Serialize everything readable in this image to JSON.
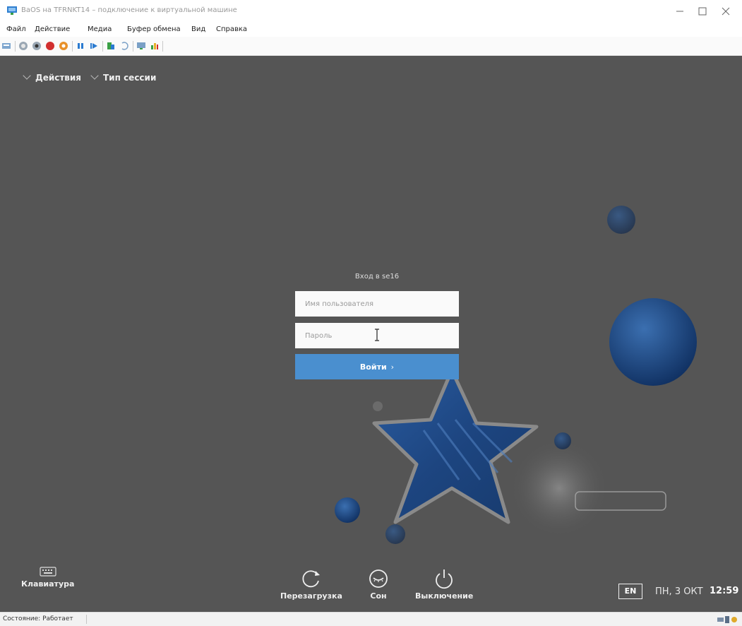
{
  "window": {
    "title": "BaOS на TFRNKT14 – подключение к виртуальной машине"
  },
  "menu": [
    "Файл",
    "Действие",
    "Медиа",
    "Буфер обмена",
    "Вид",
    "Справка"
  ],
  "toolbar_icons": [
    "ctrl-alt-del-icon",
    "start-icon",
    "turn-off-icon",
    "shutdown-icon",
    "save-state-icon",
    "pause-icon",
    "reset-icon",
    "checkpoint-icon",
    "revert-icon",
    "enhanced-session-icon",
    "share-icon"
  ],
  "session": {
    "actions_label": "Действия",
    "session_type_label": "Тип сессии"
  },
  "login": {
    "title": "Вход в se16",
    "username_placeholder": "Имя пользователя",
    "password_placeholder": "Пароль",
    "button_label": "Войти",
    "button_arrow": "›"
  },
  "bottom": {
    "keyboard_label": "Клавиатура",
    "restart_label": "Перезагрузка",
    "sleep_label": "Сон",
    "shutdown_label": "Выключение",
    "language": "EN",
    "date": "ПН, 3 ОКТ",
    "time": "12:59"
  },
  "status_bar": {
    "text": "Состояние: Работает"
  },
  "colors": {
    "screen_bg": "#555555",
    "accent": "#4a8fcf"
  }
}
